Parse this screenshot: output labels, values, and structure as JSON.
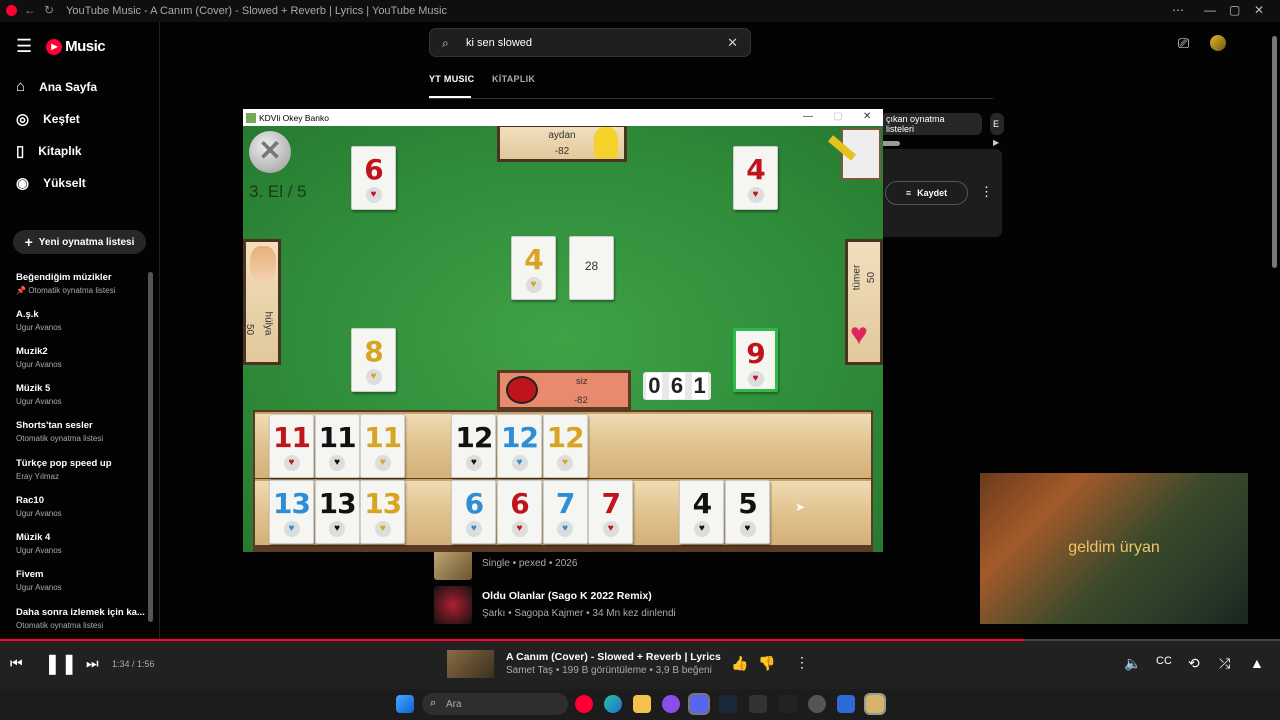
{
  "window": {
    "title": "YouTube Music - A Canım (Cover) - Slowed + Reverb | Lyrics | YouTube Music"
  },
  "sidebar": {
    "brand": "Music",
    "nav": [
      {
        "label": "Ana Sayfa",
        "icon": "home-icon"
      },
      {
        "label": "Keşfet",
        "icon": "compass-icon"
      },
      {
        "label": "Kitaplık",
        "icon": "library-icon"
      },
      {
        "label": "Yükselt",
        "icon": "upgrade-icon"
      }
    ],
    "new_playlist": "Yeni oynatma listesi",
    "playlists": [
      {
        "title": "Beğendiğim müzikler",
        "sub": "Otomatik oynatma listesi"
      },
      {
        "title": "A.ş.k",
        "sub": "Ugur Avanos"
      },
      {
        "title": "Muzik2",
        "sub": "Ugur Avanos"
      },
      {
        "title": "Müzik 5",
        "sub": "Ugur Avanos"
      },
      {
        "title": "Shorts'tan sesler",
        "sub": "Otomatik oynatma listesi"
      },
      {
        "title": "Türkçe pop speed up",
        "sub": "Eray Yılmaz"
      },
      {
        "title": "Rac10",
        "sub": "Ugur Avanos"
      },
      {
        "title": "Müzik 4",
        "sub": "Ugur Avanos"
      },
      {
        "title": "Fivem",
        "sub": "Ugur Avanos"
      },
      {
        "title": "Daha sonra izlemek için ka...",
        "sub": "Otomatik oynatma listesi"
      }
    ]
  },
  "search": {
    "value": "ki sen slowed"
  },
  "tabs": [
    {
      "label": "YT MUSIC"
    },
    {
      "label": "KİTAPLIK"
    }
  ],
  "chips": [
    "çıkan oynatma listeleri",
    "E"
  ],
  "card": {
    "save_label": "Kaydet"
  },
  "results": [
    {
      "title": "",
      "sub": "Single • pexed • 2026"
    },
    {
      "title": "Oldu Olanlar (Sago K 2022 Remix)",
      "sub": "Şarkı • Sagopa Kajmer • 34 Mn kez dinlendi"
    }
  ],
  "mini_video": {
    "lyric": "geldim üryan"
  },
  "player": {
    "time": "1:34 / 1:56",
    "progress": 0.8,
    "title": "A Canım (Cover) - Slowed + Reverb | Lyrics",
    "sub": "Samet Taş • 199 B görüntüleme • 3,9 B beğeni"
  },
  "taskbar": {
    "search_placeholder": "Ara"
  },
  "game": {
    "title": "KDVli Okey Banko",
    "round": "3. El / 5",
    "players": {
      "top": {
        "name": "aydan",
        "score": "-82"
      },
      "left": {
        "name": "hülya",
        "score": "50"
      },
      "right": {
        "name": "tümer",
        "score": "50"
      },
      "me": {
        "name": "siz",
        "score": "-82"
      }
    },
    "counter": [
      "0",
      "6",
      "1"
    ],
    "center_indicator": {
      "number": "4",
      "color": "yellow"
    },
    "deck_count": "28",
    "discards": [
      {
        "number": "6",
        "color": "red"
      },
      {
        "number": "4",
        "color": "red"
      },
      {
        "number": "8",
        "color": "yellow"
      },
      {
        "number": "9",
        "color": "red"
      }
    ],
    "rack_row1": [
      {
        "number": "11",
        "color": "red"
      },
      {
        "number": "11",
        "color": "black"
      },
      {
        "number": "11",
        "color": "yellow"
      },
      {
        "number": "",
        "color": ""
      },
      {
        "number": "12",
        "color": "black"
      },
      {
        "number": "12",
        "color": "blue"
      },
      {
        "number": "12",
        "color": "yellow"
      }
    ],
    "rack_row2": [
      {
        "number": "13",
        "color": "blue"
      },
      {
        "number": "13",
        "color": "black"
      },
      {
        "number": "13",
        "color": "yellow"
      },
      {
        "number": "",
        "color": ""
      },
      {
        "number": "6",
        "color": "blue"
      },
      {
        "number": "6",
        "color": "red"
      },
      {
        "number": "7",
        "color": "blue"
      },
      {
        "number": "7",
        "color": "red"
      },
      {
        "number": "",
        "color": ""
      },
      {
        "number": "4",
        "color": "black"
      },
      {
        "number": "5",
        "color": "black"
      }
    ]
  }
}
